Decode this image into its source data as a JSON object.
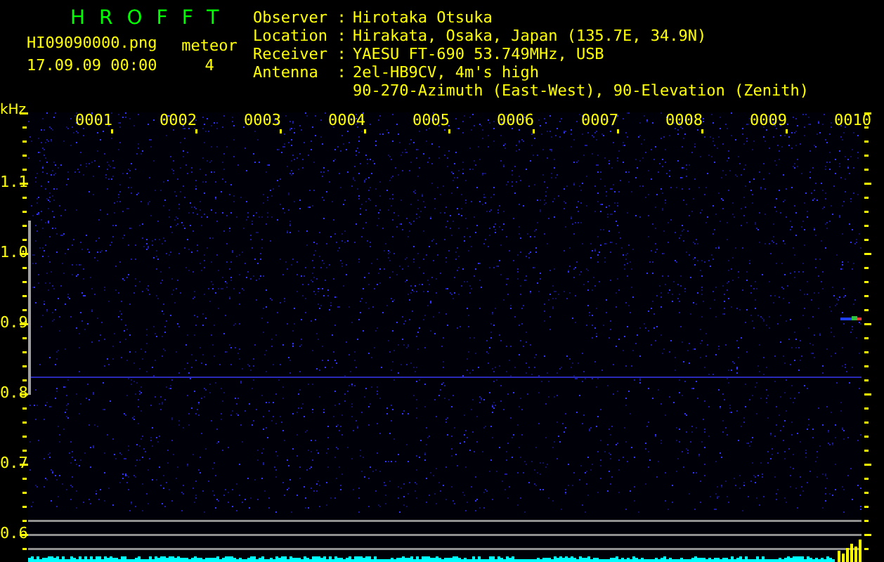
{
  "header": {
    "title": "HROFFT",
    "filename": "HI09090000.png",
    "datetime": "17.09.09 00:00",
    "meteor_label": "meteor",
    "meteor_count": "4"
  },
  "info": [
    {
      "label": "Observer",
      "separator": ":",
      "value": "Hirotaka Otsuka"
    },
    {
      "label": "Location",
      "separator": ":",
      "value": "Hirakata, Osaka, Japan (135.7E, 34.9N)"
    },
    {
      "label": "Receiver",
      "separator": ":",
      "value": "YAESU FT-690 53.749MHz, USB"
    },
    {
      "label": "Antenna",
      "separator": ":",
      "value": "2el-HB9CV, 4m's high"
    },
    {
      "value": "90-270-Azimuth (East-West), 90-Elevation (Zenith)"
    }
  ],
  "spectrogram": {
    "unit": "kHz",
    "time_labels": [
      "0001",
      "0002",
      "0003",
      "0004",
      "0005",
      "0006",
      "0007",
      "0008",
      "0009",
      "0010"
    ],
    "freq_labels": [
      "1.1",
      "1.0",
      "0.9",
      "0.8",
      "0.7",
      "0.6"
    ]
  }
}
